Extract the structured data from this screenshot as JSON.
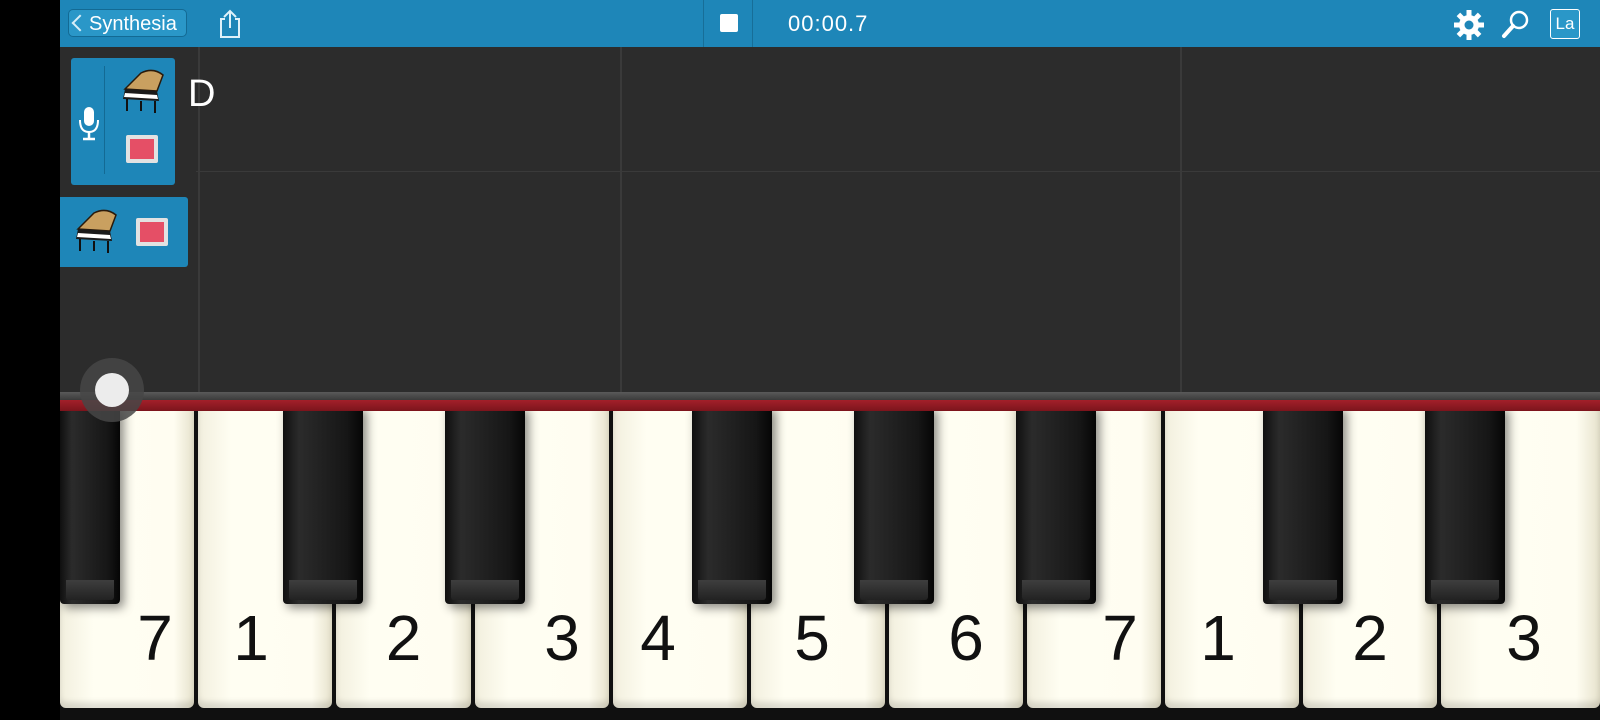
{
  "topbar": {
    "back_label": "Synthesia",
    "timecode": "00:00.7",
    "language_button": "La"
  },
  "track_area": {
    "current_note": "D",
    "tracks": [
      {
        "instrument_icon": "grand-piano-icon",
        "record_state": "off"
      },
      {
        "instrument_icon": "grand-piano-icon",
        "record_state": "off"
      }
    ]
  },
  "keyboard": {
    "white_key_labels": [
      "7",
      "1",
      "2",
      "3",
      "4",
      "5",
      "6",
      "7",
      "1",
      "2",
      "3"
    ]
  },
  "colors": {
    "toolbar": "#1e86b8",
    "track_area": "#2c2c2c",
    "felt": "#a3202a",
    "record_square": "#e54f66"
  }
}
